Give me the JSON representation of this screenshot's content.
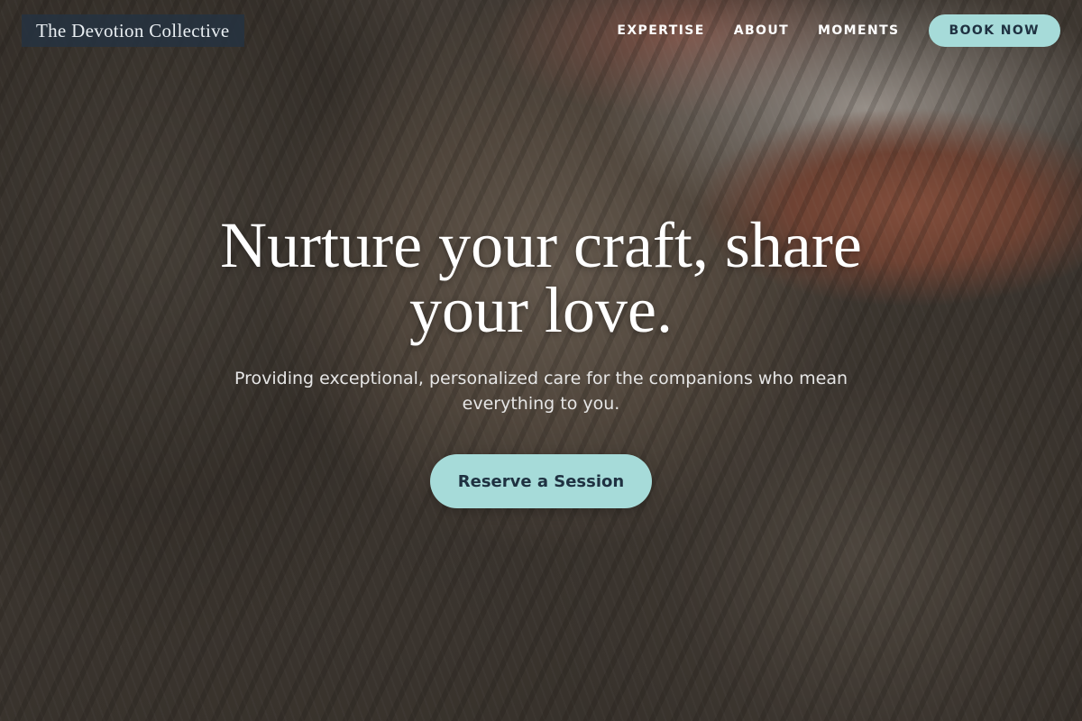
{
  "header": {
    "brand": "The Devotion Collective",
    "nav": [
      {
        "label": "EXPERTISE"
      },
      {
        "label": "ABOUT"
      },
      {
        "label": "MOMENTS"
      }
    ],
    "book_label": "BOOK NOW"
  },
  "hero": {
    "title": "Nurture your craft, share your love.",
    "subtitle": "Providing exceptional, personalized care for the companions who mean everything to you.",
    "cta_label": "Reserve a Session"
  },
  "colors": {
    "accent": "#a6dbd9",
    "accent_text": "#1f3141",
    "brand_bg": "#263240"
  }
}
